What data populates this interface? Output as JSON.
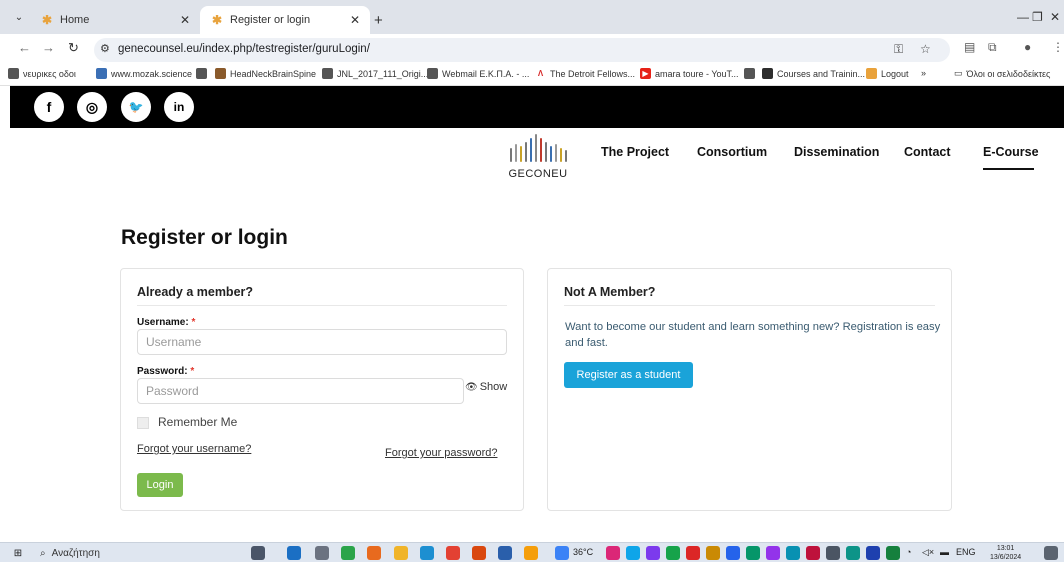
{
  "browser": {
    "tabs": [
      {
        "label": "Home",
        "active": false
      },
      {
        "label": "Register or login",
        "active": true
      }
    ],
    "url": "genecounsel.eu/index.php/testregister/guruLogin/",
    "bookmarks": [
      "νευρικες οδοι",
      "www.mozak.science",
      "HeadNeckBrainSpine",
      "JNL_2017_111_Origi...",
      "Webmail Ε.Κ.Π.Α. - ...",
      "The Detroit Fellows...",
      "amara toure - YouT...",
      "Courses and Trainin...",
      "Logout",
      "Όλοι οι σελιδοδείκτες"
    ]
  },
  "social": [
    "f",
    "◎",
    "🐦",
    "in"
  ],
  "site": {
    "logo_text": "GECONEU",
    "nav": [
      "The Project",
      "Consortium",
      "Dissemination",
      "Contact",
      "E-Course"
    ]
  },
  "main": {
    "title": "Register or login",
    "member": {
      "heading": "Already a member?",
      "username_label": "Username:",
      "username_placeholder": "Username",
      "password_label": "Password:",
      "password_placeholder": "Password",
      "required_mark": "*",
      "show_label": "Show",
      "remember_label": "Remember Me",
      "forgot_username": "Forgot your username?",
      "forgot_password": "Forgot your password?",
      "login_button": "Login"
    },
    "non_member": {
      "heading": "Not A Member?",
      "text": "Want to become our student and learn something new? Registration is easy and fast.",
      "register_button": "Register as a student"
    }
  },
  "taskbar": {
    "search_placeholder": "Αναζήτηση",
    "temperature": "36°C",
    "language": "ENG",
    "time": "13:01",
    "date": "13/6/2024"
  },
  "colors": {
    "login_button": "#7cba4c",
    "register_button": "#1aa3d9",
    "social_bar": "#000000"
  }
}
